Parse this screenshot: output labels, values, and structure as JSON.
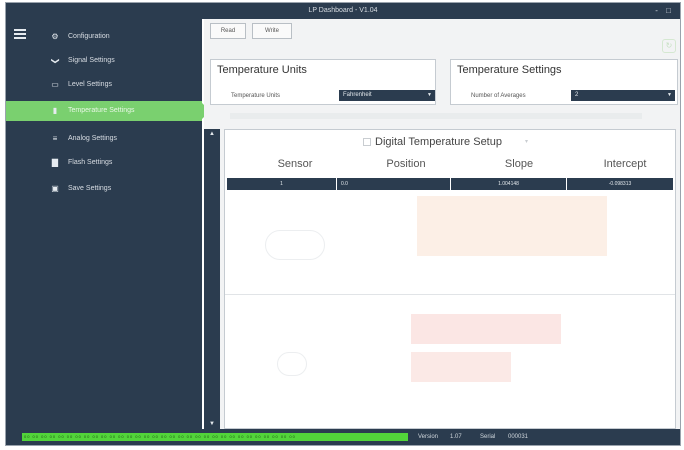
{
  "window": {
    "title": "LP Dashboard - V1.04",
    "controls": "- □"
  },
  "sidebar": {
    "items": [
      {
        "label": "Configuration",
        "icon": "gear-icon",
        "glyph": "⚙"
      },
      {
        "label": "Signal Settings",
        "icon": "chevron-down-icon",
        "glyph": "❯"
      },
      {
        "label": "Level Settings",
        "icon": "level-icon",
        "glyph": "▭"
      },
      {
        "label": "Temperature Settings",
        "icon": "thermometer-icon",
        "glyph": "▮"
      },
      {
        "label": "Analog Settings",
        "icon": "analog-icon",
        "glyph": "≡"
      },
      {
        "label": "Flash Settings",
        "icon": "flash-icon",
        "glyph": "▇"
      },
      {
        "label": "Save Settings",
        "icon": "save-icon",
        "glyph": "▣"
      }
    ],
    "active_index": 3
  },
  "toolbar": {
    "read_label": "Read",
    "write_label": "Write"
  },
  "temperature_units": {
    "title": "Temperature Units",
    "field_label": "Temperature Units",
    "value": "Fahrenheit"
  },
  "temperature_settings": {
    "title": "Temperature Settings",
    "field_label": "Number of Averages",
    "value": "2"
  },
  "digital_setup": {
    "title": "Digital Temperature Setup",
    "columns": [
      "Sensor",
      "Position",
      "Slope",
      "Intercept"
    ],
    "row": {
      "sensor": "1",
      "position": "0.0",
      "slope": "1.004148",
      "intercept": "-0.098313"
    }
  },
  "status": {
    "leds": "00 00 00 00 00 00 00 00 00 00 00 00 00 00 00 00 00 00 00 00 00 00 00 00 00 00 00 00 00 00 00 00",
    "version_label": "Version",
    "version_value": "1.07",
    "serial_label": "Serial",
    "serial_value": "000031"
  },
  "colors": {
    "sidebar": "#2b3c4f",
    "accent": "#7ad06f",
    "led": "#52d43a"
  }
}
